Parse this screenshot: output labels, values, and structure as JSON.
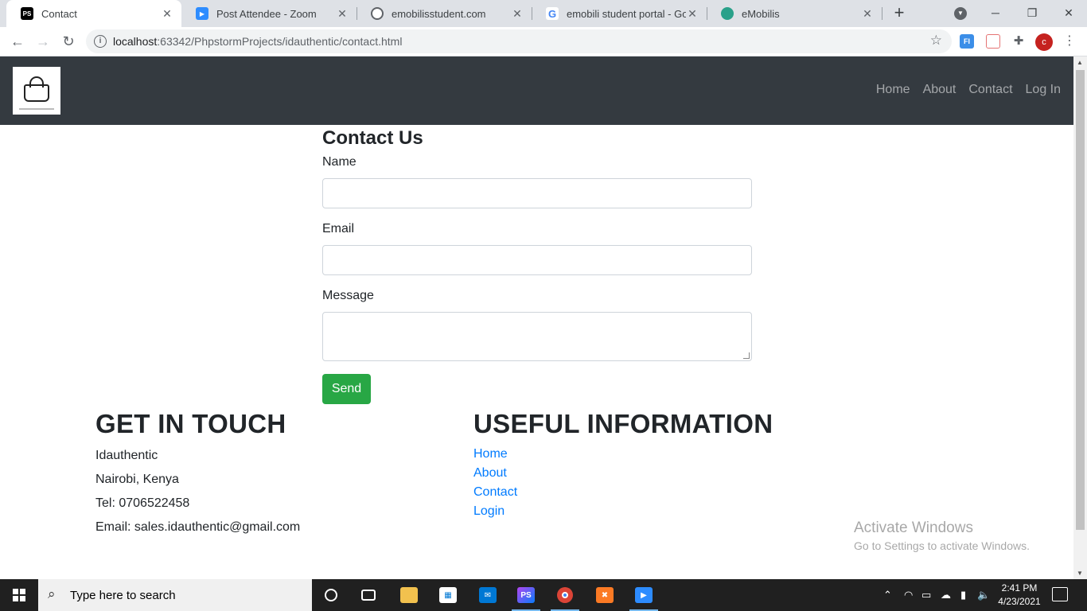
{
  "browser": {
    "tabs": [
      {
        "title": "Contact",
        "favicon": "phpstorm-icon",
        "fav_text": "PS",
        "color": "#000000"
      },
      {
        "title": "Post Attendee - Zoom",
        "favicon": "zoom-icon",
        "fav_text": "",
        "color": "#2d8cff"
      },
      {
        "title": "emobilisstudent.com",
        "favicon": "globe-icon",
        "fav_text": "",
        "color": "#5f6368"
      },
      {
        "title": "emobili student portal - Goo",
        "favicon": "google-icon",
        "fav_text": "G",
        "color": "#ffffff"
      },
      {
        "title": "eMobilis",
        "favicon": "emobilis-icon",
        "fav_text": "",
        "color": "#2aa18a"
      }
    ],
    "url_host": "localhost",
    "url_rest": ":63342/PhpstormProjects/idauthentic/contact.html",
    "new_tab": "+",
    "profile_initial": "c"
  },
  "site": {
    "nav": {
      "home": "Home",
      "about": "About",
      "contact": "Contact",
      "login": "Log In"
    },
    "contact": {
      "title": "Contact Us",
      "name_label": "Name",
      "email_label": "Email",
      "message_label": "Message",
      "send_label": "Send"
    },
    "footer": {
      "left_title": "GET IN TOUCH",
      "company": "Idauthentic",
      "location": "Nairobi, Kenya",
      "tel": "Tel: 0706522458",
      "email": "Email: sales.idauthentic@gmail.com",
      "right_title": "USEFUL INFORMATION",
      "links": [
        "Home",
        "About",
        "Contact",
        "Login"
      ]
    },
    "watermark": {
      "line1": "Activate Windows",
      "line2": "Go to Settings to activate Windows."
    }
  },
  "taskbar": {
    "search_placeholder": "Type here to search",
    "time": "2:41 PM",
    "date": "4/23/2021"
  },
  "colors": {
    "navbar_bg": "#343a40",
    "send_button": "#28a745",
    "link": "#007bff"
  }
}
